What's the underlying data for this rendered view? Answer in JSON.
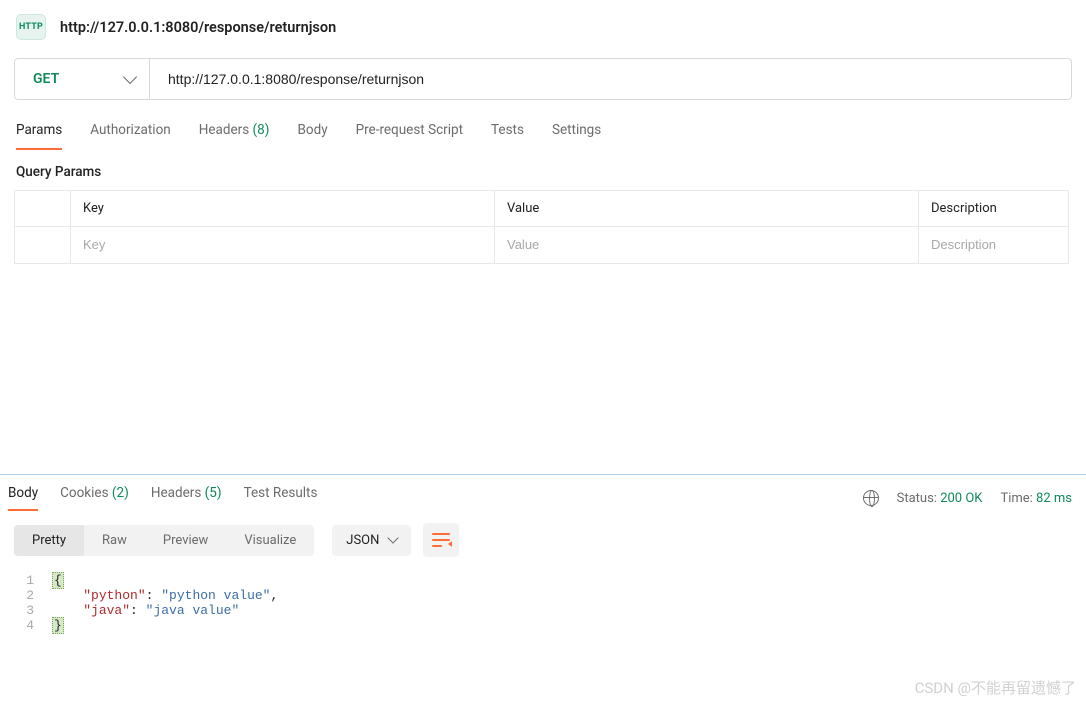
{
  "header": {
    "badge": "HTTP",
    "title": "http://127.0.0.1:8080/response/returnjson"
  },
  "request": {
    "method": "GET",
    "url": "http://127.0.0.1:8080/response/returnjson"
  },
  "reqTabs": {
    "params": "Params",
    "auth": "Authorization",
    "headers_label": "Headers",
    "headers_count": "(8)",
    "body": "Body",
    "prescript": "Pre-request Script",
    "tests": "Tests",
    "settings": "Settings"
  },
  "querySection": {
    "title": "Query Params",
    "th_key": "Key",
    "th_value": "Value",
    "th_desc": "Description",
    "ph_key": "Key",
    "ph_value": "Value",
    "ph_desc": "Description"
  },
  "respTabs": {
    "body": "Body",
    "cookies_label": "Cookies",
    "cookies_count": "(2)",
    "headers_label": "Headers",
    "headers_count": "(5)",
    "testResults": "Test Results"
  },
  "respMeta": {
    "status_label": "Status:",
    "status_value": "200 OK",
    "time_label": "Time:",
    "time_value": "82 ms"
  },
  "viewBar": {
    "pretty": "Pretty",
    "raw": "Raw",
    "preview": "Preview",
    "visualize": "Visualize",
    "format": "JSON"
  },
  "code": {
    "l1_num": "1",
    "l1_brace": "{",
    "l2_num": "2",
    "l2_indent": "    ",
    "l2_key": "\"python\"",
    "l2_colon": ": ",
    "l2_val": "\"python value\"",
    "l2_comma": ",",
    "l3_num": "3",
    "l3_indent": "    ",
    "l3_key": "\"java\"",
    "l3_colon": ": ",
    "l3_val": "\"java value\"",
    "l4_num": "4",
    "l4_brace": "}"
  },
  "watermark": "CSDN @不能再留遗憾了"
}
